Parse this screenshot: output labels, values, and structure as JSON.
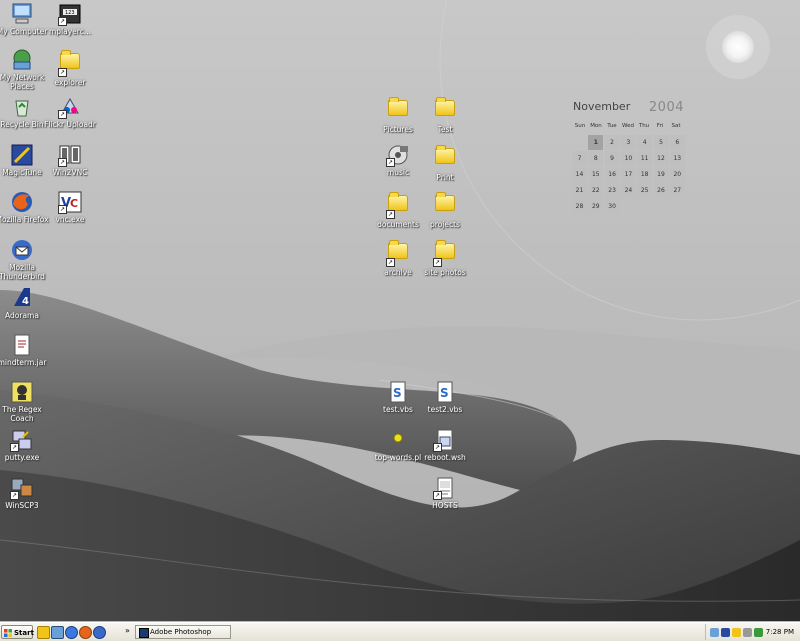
{
  "desktop": {
    "icons_left": [
      {
        "label": "My Computer",
        "icon": "computer-icon"
      },
      {
        "label": "mplayerc...",
        "icon": "media-player-icon"
      },
      {
        "label": "My Network Places",
        "icon": "network-icon"
      },
      {
        "label": "explorer",
        "icon": "explorer-icon"
      },
      {
        "label": "Recycle Bin",
        "icon": "recycle-bin-icon"
      },
      {
        "label": "Flickr Uploadr",
        "icon": "flickr-icon"
      },
      {
        "label": "MagicTune",
        "icon": "magictune-icon"
      },
      {
        "label": "Win2VNC",
        "icon": "win2vnc-icon"
      },
      {
        "label": "Mozilla Firefox",
        "icon": "firefox-icon"
      },
      {
        "label": "vnc.exe",
        "icon": "vnc-icon"
      },
      {
        "label": "Mozilla Thunderbird",
        "icon": "thunderbird-icon"
      },
      {
        "label": "Adorama",
        "icon": "adorama-icon"
      },
      {
        "label": "mindterm.jar",
        "icon": "jar-icon"
      },
      {
        "label": "The Regex Coach",
        "icon": "regex-coach-icon"
      },
      {
        "label": "putty.exe",
        "icon": "putty-icon"
      },
      {
        "label": "WinSCP3",
        "icon": "winscp-icon"
      }
    ],
    "icons_center": [
      {
        "label": "Pictures",
        "icon": "folder-icon"
      },
      {
        "label": "Test",
        "icon": "folder-icon"
      },
      {
        "label": "music",
        "icon": "music-icon"
      },
      {
        "label": "Print",
        "icon": "folder-icon"
      },
      {
        "label": "documents",
        "icon": "documents-icon"
      },
      {
        "label": "projects",
        "icon": "folder-icon"
      },
      {
        "label": "archive",
        "icon": "folder-icon"
      },
      {
        "label": "site photos",
        "icon": "folder-icon"
      },
      {
        "label": "test.vbs",
        "icon": "vbs-script-icon"
      },
      {
        "label": "test2.vbs",
        "icon": "vbs-script-icon"
      },
      {
        "label": "top-words.pl",
        "icon": "perl-script-icon"
      },
      {
        "label": "reboot.wsh",
        "icon": "wsh-script-icon"
      },
      {
        "label": "HOSTS",
        "icon": "text-file-icon"
      }
    ]
  },
  "calendar": {
    "month": "November",
    "year": "2004",
    "weekdays": [
      "Sun",
      "Mon",
      "Tue",
      "Wed",
      "Thu",
      "Fri",
      "Sat"
    ],
    "days": [
      "1",
      "2",
      "3",
      "4",
      "5",
      "6",
      "7",
      "8",
      "9",
      "10",
      "11",
      "12",
      "13",
      "14",
      "15",
      "16",
      "17",
      "18",
      "19",
      "20",
      "21",
      "22",
      "23",
      "24",
      "25",
      "26",
      "27",
      "28",
      "29",
      "30"
    ],
    "today": "1"
  },
  "taskbar": {
    "start_label": "Start",
    "chevron": "»",
    "tasks": [
      {
        "label": "Adobe Photoshop",
        "icon": "photoshop-icon"
      }
    ],
    "clock": "7:28 PM"
  },
  "colors": {
    "folder": "#f0c419",
    "taskbar": "#ece9d8"
  }
}
